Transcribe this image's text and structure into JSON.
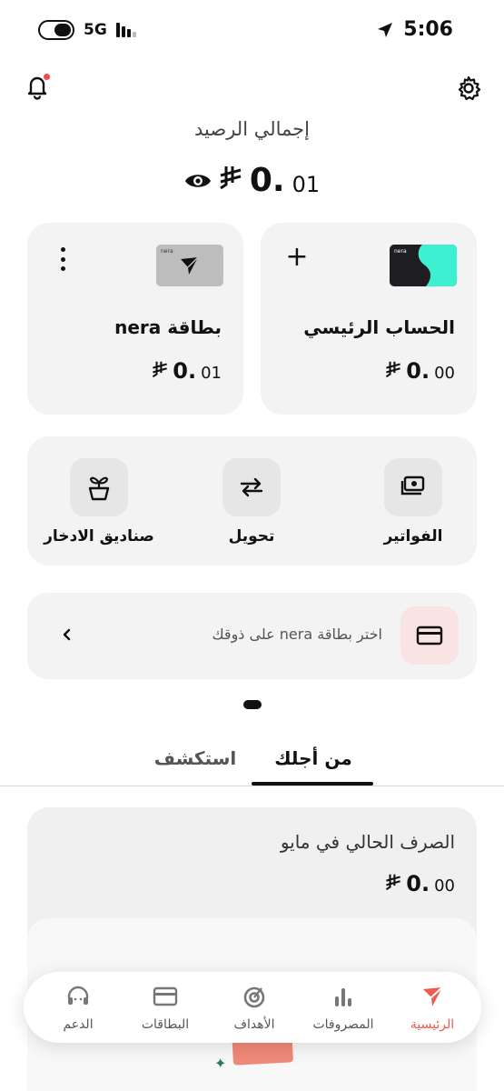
{
  "status_bar": {
    "network": "5G",
    "time": "5:06"
  },
  "balance": {
    "title": "إجمالي الرصيد",
    "amount_major": "0.",
    "amount_minor": "01",
    "currency_symbol": "⃁"
  },
  "accounts": [
    {
      "title": "الحساب الرئيسي",
      "amount_major": "0.",
      "amount_minor": "00",
      "card_brand": "nera",
      "card_color": "#1d1d22",
      "accent": "#3ef0d2"
    },
    {
      "title": "بطاقة nera",
      "amount_major": "0.",
      "amount_minor": "01",
      "card_brand": "nera",
      "card_color": "#bdbdbd"
    }
  ],
  "add_account_label": "+",
  "actions": [
    {
      "label": "الفواتير",
      "icon": "bills-icon"
    },
    {
      "label": "تحويل",
      "icon": "transfer-icon"
    },
    {
      "label": "صناديق الادخار",
      "icon": "savings-plant-icon"
    }
  ],
  "promo": {
    "text": "اختر بطاقة nera على ذوقك",
    "icon": "card-icon"
  },
  "tabs": {
    "for_you": "من أجلك",
    "explore": "استكشف",
    "active": "for_you"
  },
  "spend": {
    "title": "الصرف الحالي في مايو",
    "amount_major": "0.",
    "amount_minor": "00"
  },
  "bottom_nav": [
    {
      "label": "الرئيسية",
      "icon": "home-arrow-icon",
      "active": true
    },
    {
      "label": "المصروفات",
      "icon": "bar-chart-icon",
      "active": false
    },
    {
      "label": "الأهداف",
      "icon": "target-icon",
      "active": false
    },
    {
      "label": "البطاقات",
      "icon": "card-icon",
      "active": false
    },
    {
      "label": "الدعم",
      "icon": "headset-icon",
      "active": false
    }
  ],
  "colors": {
    "accent": "#ef5a4e",
    "surface": "#f3f3f3",
    "notification_dot": "#ef4b4b"
  }
}
